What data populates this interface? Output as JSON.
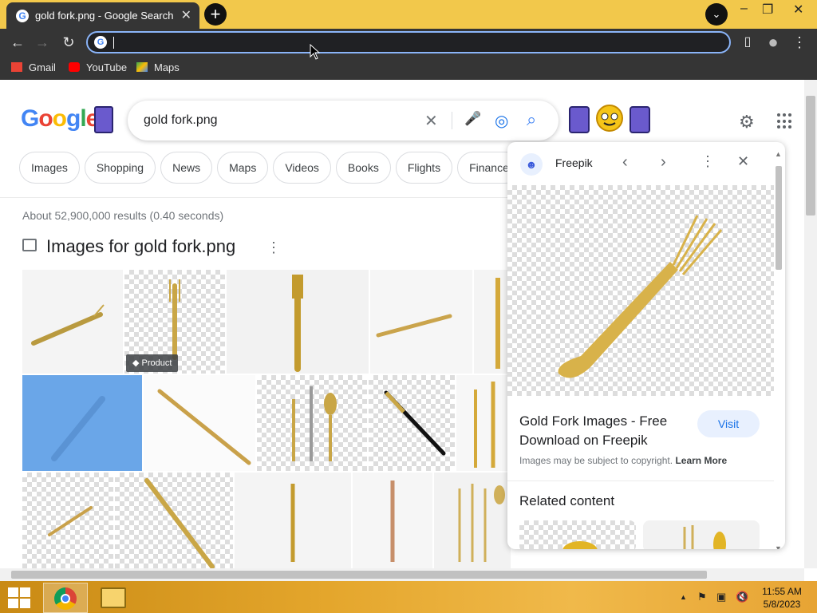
{
  "browser": {
    "tab_title": "gold fork.png - Google Search",
    "tab_close": "✕",
    "new_tab": "+",
    "tab_search": "⌄",
    "window_controls": [
      "–",
      "❐",
      "✕"
    ],
    "nav": {
      "back": "←",
      "forward": "→",
      "reload": "↻"
    },
    "omnibox_value": "",
    "side_panel_icon": "▯",
    "profile_icon": "●",
    "menu_icon": "⋮",
    "bookmarks": [
      "Gmail",
      "YouTube",
      "Maps"
    ]
  },
  "search": {
    "logo": "Google",
    "query": "gold fork.png",
    "clear": "✕",
    "mic": "🎤",
    "lens": "◎",
    "submit": "⌕",
    "settings": "⚙",
    "filters": [
      "Images",
      "Shopping",
      "News",
      "Maps",
      "Videos",
      "Books",
      "Flights",
      "Finance"
    ],
    "stats": "About 52,900,000 results (0.40 seconds)",
    "images_header": "Images for gold fork.png",
    "more": "⋮",
    "product_badge": "Product"
  },
  "panel": {
    "source": "Freepik",
    "prev": "‹",
    "next": "›",
    "more": "⋮",
    "close": "✕",
    "title": "Gold Fork Images - Free Download on Freepik",
    "visit": "Visit",
    "copyright": "Images may be subject to copyright.",
    "learn_more": "Learn More",
    "related": "Related content"
  },
  "taskbar": {
    "time": "11:55 AM",
    "date": "5/8/2023",
    "tray": [
      "▲",
      "⚑",
      "▣",
      "🔇"
    ]
  },
  "colors": {
    "titlebar": "#f2c84b",
    "chrome_dark": "#353535",
    "focus_ring": "#8ab4f8",
    "gold": "#d8b24a"
  }
}
